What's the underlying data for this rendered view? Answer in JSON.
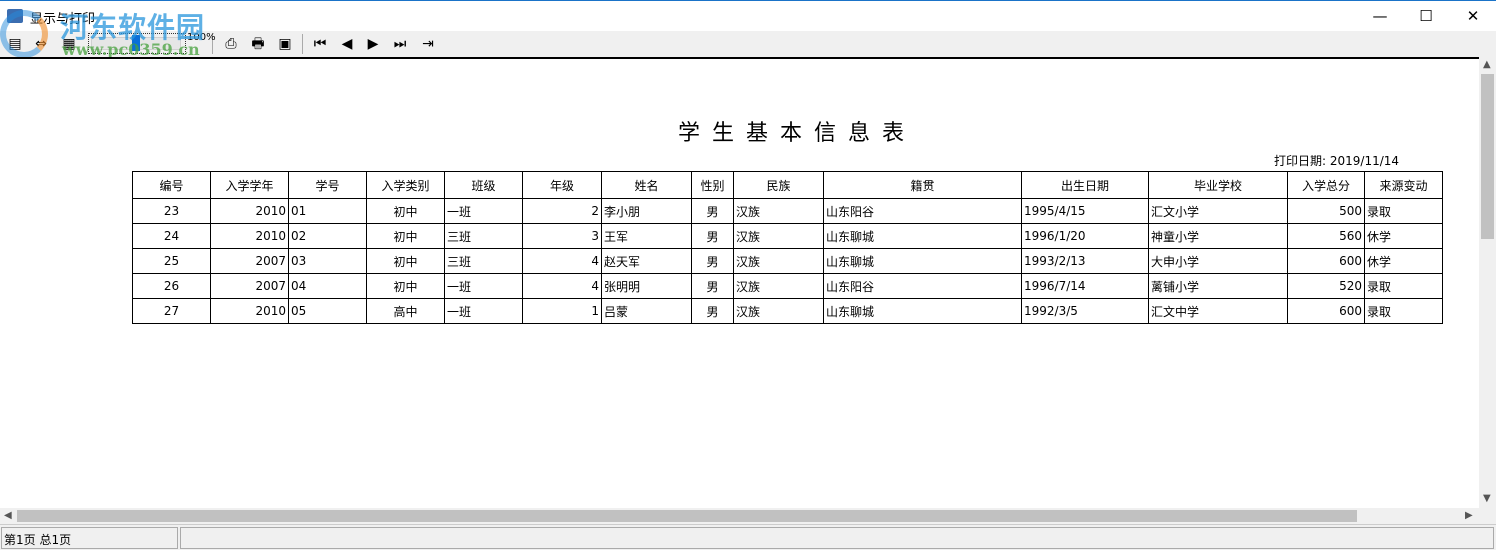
{
  "window": {
    "title": "显示与打印",
    "minimize": "—",
    "maximize": "☐",
    "close": "✕"
  },
  "watermark": {
    "name": "河东软件园",
    "url": "www.pc0359.cn"
  },
  "toolbar": {
    "zoom_label": "100%",
    "zoom_value_percent": 100,
    "icons": {
      "page": "▤",
      "width": "⇔",
      "whole": "▦",
      "print_setup": "⎙",
      "print": "🖶",
      "print_options": "▣",
      "first": "⏮",
      "prev": "◀",
      "next": "▶",
      "last": "⏭",
      "exit": "⇥"
    }
  },
  "report": {
    "title": "学生基本信息表",
    "print_date": "打印日期: 2019/11/14",
    "columns": [
      "编号",
      "入学学年",
      "学号",
      "入学类别",
      "班级",
      "年级",
      "姓名",
      "性别",
      "民族",
      "籍贯",
      "出生日期",
      "毕业学校",
      "入学总分",
      "来源变动"
    ],
    "rows": [
      [
        "23",
        "2010",
        "01",
        "初中",
        "一班",
        "2",
        "李小朋",
        "男",
        "汉族",
        "山东阳谷",
        "1995/4/15",
        "汇文小学",
        "500",
        "录取"
      ],
      [
        "24",
        "2010",
        "02",
        "初中",
        "三班",
        "3",
        "王军",
        "男",
        "汉族",
        "山东聊城",
        "1996/1/20",
        "神童小学",
        "560",
        "休学"
      ],
      [
        "25",
        "2007",
        "03",
        "初中",
        "三班",
        "4",
        "赵天军",
        "男",
        "汉族",
        "山东聊城",
        "1993/2/13",
        "大申小学",
        "600",
        "休学"
      ],
      [
        "26",
        "2007",
        "04",
        "初中",
        "一班",
        "4",
        "张明明",
        "男",
        "汉族",
        "山东阳谷",
        "1996/7/14",
        "蓠铺小学",
        "520",
        "录取"
      ],
      [
        "27",
        "2010",
        "05",
        "高中",
        "一班",
        "1",
        "吕蒙",
        "男",
        "汉族",
        "山东聊城",
        "1992/3/5",
        "汇文中学",
        "600",
        "录取"
      ]
    ]
  },
  "status": {
    "pages": "第1页 总1页"
  }
}
